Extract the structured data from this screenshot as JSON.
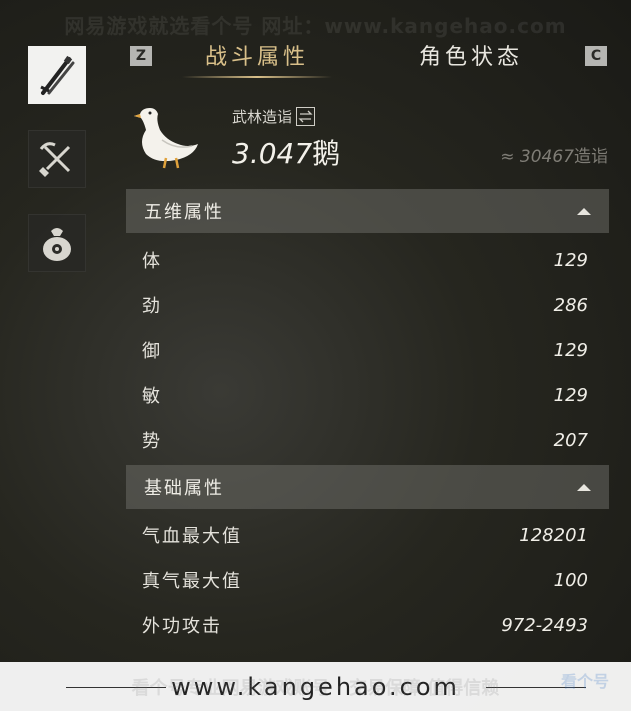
{
  "watermark": {
    "top": "网易游戏就选看个号  网址：www.kangehao.com",
    "bottom_overlay": "看个号专业网易游戏账号 · 交易保障 值得信赖",
    "corner_logo": "看个号"
  },
  "tabs": {
    "left_key": "Z",
    "right_key": "C",
    "items": [
      {
        "label": "战斗属性",
        "active": true
      },
      {
        "label": "角色状态",
        "active": false
      }
    ]
  },
  "sidebar": {
    "items": [
      {
        "icon": "sword-icon",
        "active": true
      },
      {
        "icon": "tools-icon",
        "active": false
      },
      {
        "icon": "money-bag-icon",
        "active": false
      }
    ]
  },
  "profile": {
    "rank_label": "武林造诣",
    "rank_value": "3.047",
    "rank_unit": "鹅",
    "approx_symbol": "≈",
    "approx_value": "30467",
    "approx_unit": "造诣"
  },
  "sections": {
    "five_dims": {
      "title": "五维属性",
      "rows": [
        {
          "label": "体",
          "value": "129"
        },
        {
          "label": "劲",
          "value": "286"
        },
        {
          "label": "御",
          "value": "129"
        },
        {
          "label": "敏",
          "value": "129"
        },
        {
          "label": "势",
          "value": "207"
        }
      ]
    },
    "basic": {
      "title": "基础属性",
      "rows": [
        {
          "label": "气血最大值",
          "value": "128201"
        },
        {
          "label": "真气最大值",
          "value": "100"
        },
        {
          "label": "外功攻击",
          "value": "972-2493"
        }
      ]
    }
  },
  "footer": {
    "url": "www.kangehao.com"
  },
  "colors": {
    "accent": "#d9c08a",
    "section_bg": "#69696a"
  }
}
